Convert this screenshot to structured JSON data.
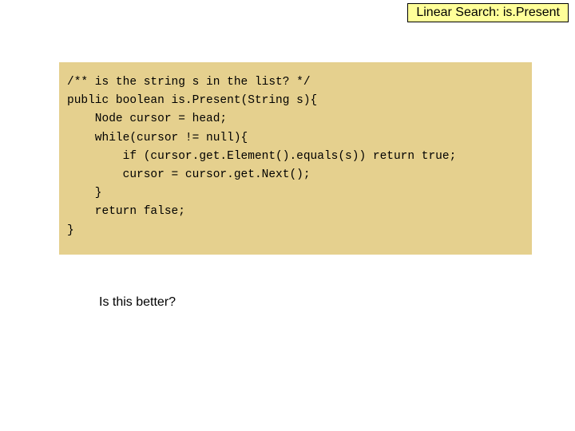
{
  "title": "Linear Search: is.Present",
  "code": "/** is the string s in the list? */\npublic boolean is.Present(String s){\n    Node cursor = head;\n    while(cursor != null){\n        if (cursor.get.Element().equals(s)) return true;\n        cursor = cursor.get.Next();\n    }\n    return false;\n}",
  "question": "Is this better?"
}
